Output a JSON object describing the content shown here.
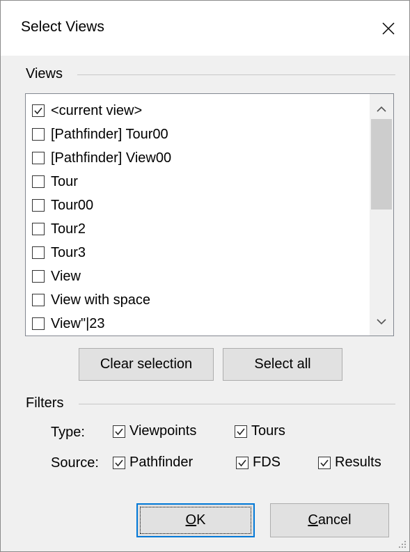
{
  "dialog": {
    "title": "Select Views",
    "close_icon": "close-icon"
  },
  "views_group": {
    "label": "Views",
    "items": [
      {
        "label": "<current view>",
        "checked": true
      },
      {
        "label": "[Pathfinder] Tour00",
        "checked": false
      },
      {
        "label": "[Pathfinder] View00",
        "checked": false
      },
      {
        "label": "Tour",
        "checked": false
      },
      {
        "label": "Tour00",
        "checked": false
      },
      {
        "label": "Tour2",
        "checked": false
      },
      {
        "label": "Tour3",
        "checked": false
      },
      {
        "label": "View",
        "checked": false
      },
      {
        "label": "View with space",
        "checked": false
      },
      {
        "label": "View\"|23",
        "checked": false
      }
    ]
  },
  "buttons": {
    "clear_selection": "Clear selection",
    "select_all": "Select all",
    "ok": {
      "mnemonic": "O",
      "rest": "K"
    },
    "cancel": {
      "mnemonic": "C",
      "rest": "ancel"
    }
  },
  "filters_group": {
    "label": "Filters",
    "type_label": "Type:",
    "source_label": "Source:",
    "type_options": [
      {
        "label": "Viewpoints",
        "checked": true
      },
      {
        "label": "Tours",
        "checked": true
      }
    ],
    "source_options": [
      {
        "label": "Pathfinder",
        "checked": true
      },
      {
        "label": "FDS",
        "checked": true
      },
      {
        "label": "Results",
        "checked": true
      }
    ]
  },
  "colors": {
    "default_button_border": "#0078d7",
    "dialog_background": "#f0f0f0"
  }
}
